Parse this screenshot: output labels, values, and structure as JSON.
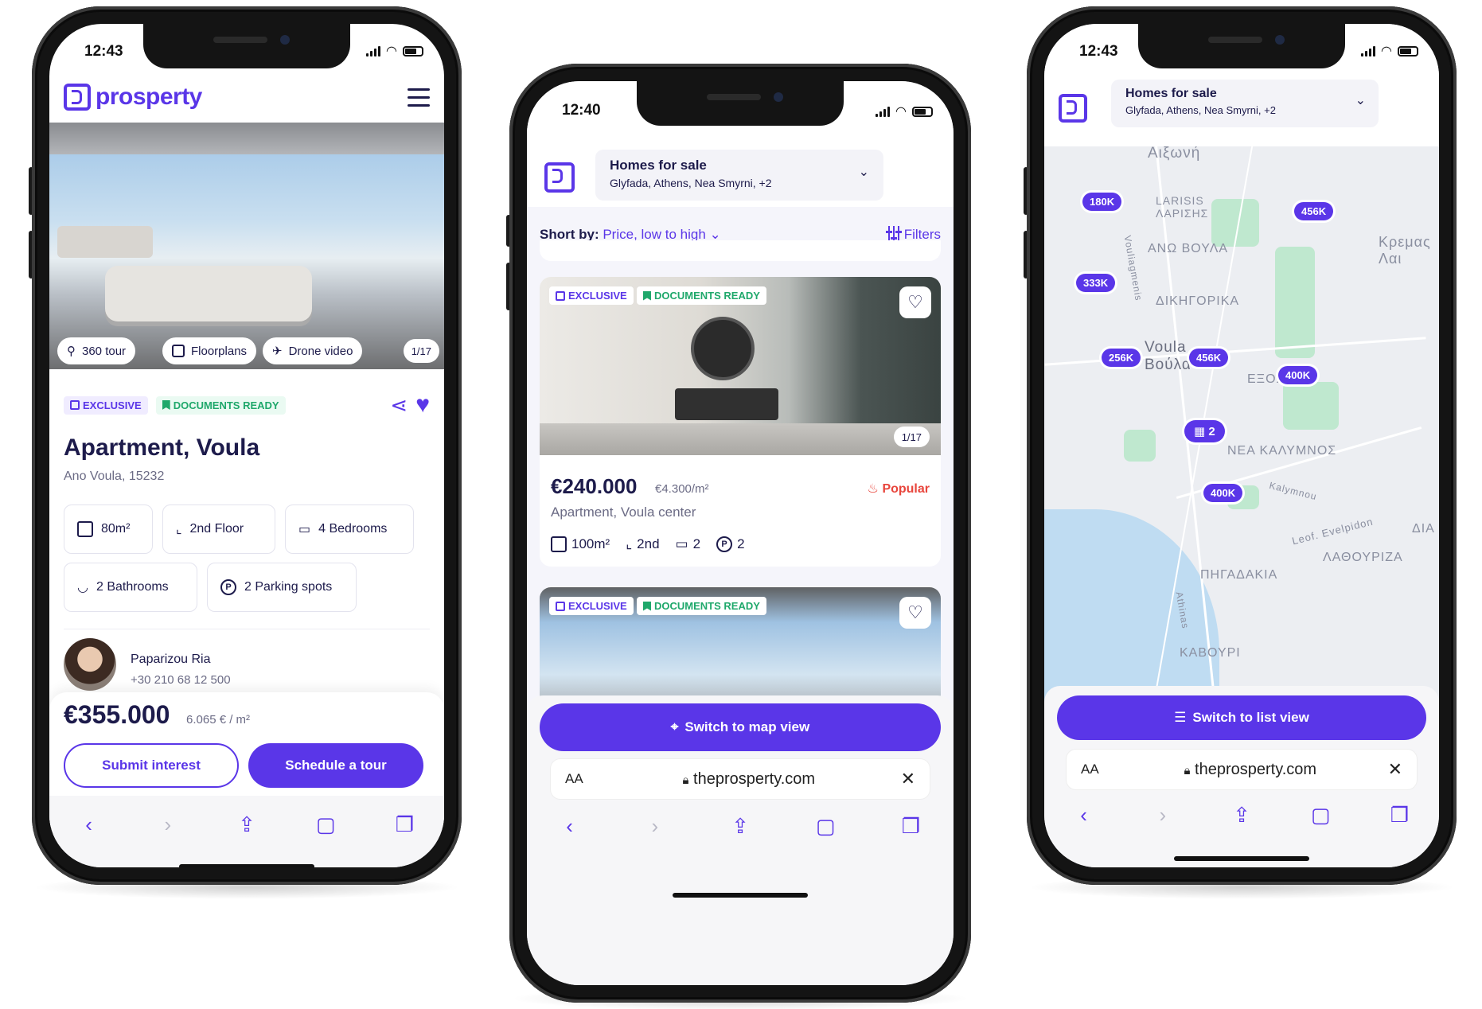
{
  "colors": {
    "brand": "#5a36e8",
    "success": "#1fa86b",
    "popular": "#e8453c",
    "text": "#1d1b4b"
  },
  "phone1": {
    "time": "12:43",
    "brand": "prosperty",
    "media": {
      "tour": "360 tour",
      "floorplans": "Floorplans",
      "drone": "Drone video",
      "counter": "1/17"
    },
    "tags": {
      "exclusive": "EXCLUSIVE",
      "documents": "DOCUMENTS READY"
    },
    "title": "Apartment, Voula",
    "address": "Ano Voula, 15232",
    "features": [
      "80m²",
      "2nd Floor",
      "4 Bedrooms",
      "2 Bathrooms",
      "2 Parking spots"
    ],
    "agent": {
      "name": "Paparizou Ria",
      "phone": "+30 210 68 12 500"
    },
    "price": "€355.000",
    "price_per": "6.065 € / m²",
    "submit": "Submit interest",
    "schedule": "Schedule a tour"
  },
  "phone2": {
    "time": "12:40",
    "search": {
      "title": "Homes for sale",
      "locations": "Glyfada, Athens, Nea Smyrni, +2"
    },
    "sort": {
      "label": "Short by:",
      "value": "Price, low to high"
    },
    "filters": "Filters",
    "listing1": {
      "exclusive": "EXCLUSIVE",
      "documents": "DOCUMENTS READY",
      "counter": "1/17",
      "price": "€240.000",
      "price_per": "€4.300/m²",
      "popular": "Popular",
      "name": "Apartment, Voula center",
      "area": "100m²",
      "floor": "2nd",
      "beds": "2",
      "parking": "2"
    },
    "listing2": {
      "exclusive": "EXCLUSIVE",
      "documents": "DOCUMENTS READY"
    },
    "map_button": "Switch to map view",
    "url": "theprosperty.com",
    "aa": "AA"
  },
  "phone3": {
    "time": "12:43",
    "search": {
      "title": "Homes for sale",
      "locations": "Glyfada, Athens, Nea Smyrni, +2"
    },
    "map_labels": [
      "Αλεχονι Αιξωνή",
      "LARISIS ΛΑΡΙΣΗΣ",
      "ΑΝΩ ΒΟΥΛΑ",
      "ΔΙΚΗΓΟΡΙΚΑ",
      "Voula Βούλα",
      "ΕΞΟΧΗ",
      "ΝΕΑ ΚΑΛΥΜΝΟΣ",
      "ΛΑΘΟΥΡΙΖΑ",
      "ΠΗΓΑΔΑΚΙΑ",
      "ΚΑΒΟΥΡΙ",
      "Κρεμας Λαι",
      "ΔΙΑ",
      "Leof. Evelpidon",
      "Vouliagmenis",
      "Kalymnou",
      "Athinas"
    ],
    "pins": [
      "180K",
      "456K",
      "333K",
      "256K",
      "456K",
      "400K",
      "2",
      "400K"
    ],
    "list_button": "Switch to list view",
    "url": "theprosperty.com",
    "aa": "AA"
  }
}
